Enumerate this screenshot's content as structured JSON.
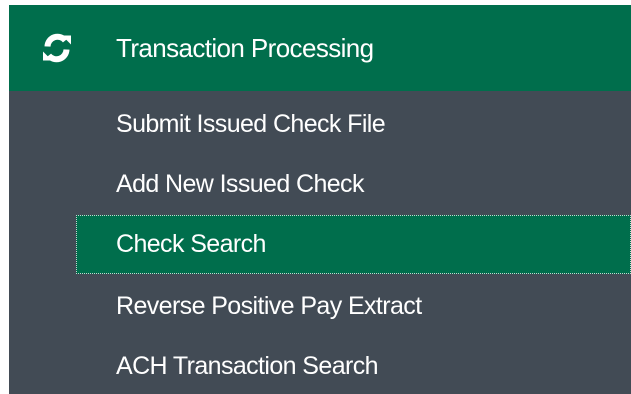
{
  "section": {
    "title": "Transaction Processing",
    "icon": "refresh-icon",
    "header_color": "#006e4c"
  },
  "menu": {
    "items": [
      {
        "label": "Submit Issued Check File",
        "active": false
      },
      {
        "label": "Add New Issued Check",
        "active": false
      },
      {
        "label": "Check Search",
        "active": true
      },
      {
        "label": "Reverse Positive Pay Extract",
        "active": false
      },
      {
        "label": "ACH Transaction Search",
        "active": false
      }
    ],
    "background_color": "#424b55",
    "active_color": "#006e4c",
    "text_color": "#ffffff"
  }
}
